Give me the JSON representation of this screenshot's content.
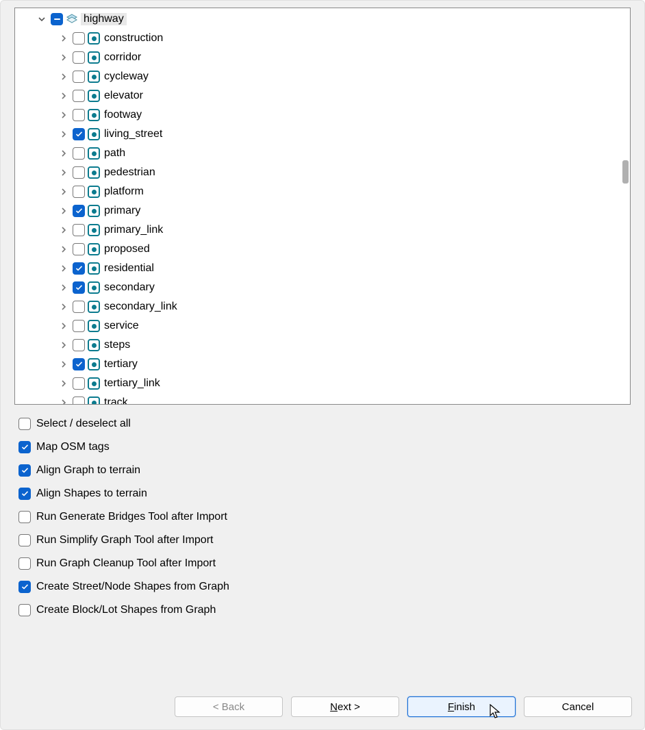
{
  "tree": {
    "root_label": "highway",
    "root_indeterminate": true,
    "children": [
      {
        "label": "construction",
        "checked": false
      },
      {
        "label": "corridor",
        "checked": false
      },
      {
        "label": "cycleway",
        "checked": false
      },
      {
        "label": "elevator",
        "checked": false
      },
      {
        "label": "footway",
        "checked": false
      },
      {
        "label": "living_street",
        "checked": true
      },
      {
        "label": "path",
        "checked": false
      },
      {
        "label": "pedestrian",
        "checked": false
      },
      {
        "label": "platform",
        "checked": false
      },
      {
        "label": "primary",
        "checked": true
      },
      {
        "label": "primary_link",
        "checked": false
      },
      {
        "label": "proposed",
        "checked": false
      },
      {
        "label": "residential",
        "checked": true
      },
      {
        "label": "secondary",
        "checked": true
      },
      {
        "label": "secondary_link",
        "checked": false
      },
      {
        "label": "service",
        "checked": false
      },
      {
        "label": "steps",
        "checked": false
      },
      {
        "label": "tertiary",
        "checked": true
      },
      {
        "label": "tertiary_link",
        "checked": false
      },
      {
        "label": "track",
        "checked": false
      }
    ]
  },
  "options": [
    {
      "label": "Select / deselect all",
      "checked": false
    },
    {
      "label": "Map OSM tags",
      "checked": true
    },
    {
      "label": "Align Graph to terrain",
      "checked": true
    },
    {
      "label": "Align Shapes to terrain",
      "checked": true
    },
    {
      "label": "Run Generate Bridges Tool after Import",
      "checked": false
    },
    {
      "label": "Run Simplify Graph Tool after Import",
      "checked": false
    },
    {
      "label": "Run Graph Cleanup Tool after Import",
      "checked": false
    },
    {
      "label": "Create Street/Node Shapes from Graph",
      "checked": true
    },
    {
      "label": "Create Block/Lot Shapes from Graph",
      "checked": false
    }
  ],
  "buttons": {
    "back": "< Back",
    "next_prefix": "N",
    "next_suffix": "ext >",
    "finish_prefix": "F",
    "finish_suffix": "inish",
    "cancel": "Cancel"
  }
}
